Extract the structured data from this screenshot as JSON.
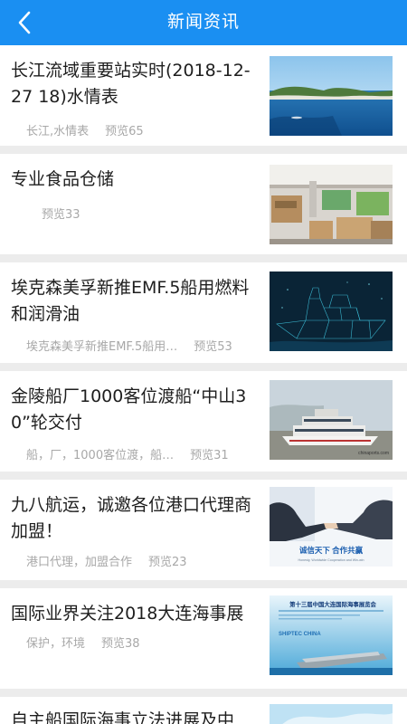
{
  "header": {
    "title": "新闻资讯",
    "back_icon": "chevron-left-icon"
  },
  "items": [
    {
      "title": "长江流域重要站实时(2018-12-27 18)水情表",
      "tags": "长江,水情表",
      "views": "预览65",
      "image": "coastal-bay-photo"
    },
    {
      "title": "专业食品仓储",
      "tags": "",
      "views": "预览33",
      "image": "warehouse-photo"
    },
    {
      "title": "埃克森美孚新推EMF.5船用燃料和润滑油",
      "tags": "埃克森美孚新推EMF.5船用…",
      "views": "预览53",
      "image": "wireframe-ship-graphic"
    },
    {
      "title": "金陵船厂1000客位渡船“中山30”轮交付",
      "tags": "船，厂，1000客位渡，船…",
      "views": "预览31",
      "image": "passenger-ferry-photo",
      "image_caption": "chinaports.com"
    },
    {
      "title": "九八航运，诚邀各位港口代理商加盟！",
      "tags": "港口代理，加盟合作",
      "views": "预览23",
      "image": "handshake-banner",
      "image_text": "诚信天下   合作共赢",
      "image_subtext": "Honesty, Worldwide Cooperation and Win-win"
    },
    {
      "title": "国际业界关注2018大连海事展",
      "tags": "保护，环境",
      "views": "预览38",
      "image": "dalian-expo-poster",
      "image_text": "第十三届中国大连国际海事展览会",
      "image_subtext": "SHIPTEC CHINA"
    },
    {
      "title": "自主船国际海事立法进展及中",
      "tags": "",
      "views": "",
      "image": "sky-photo"
    }
  ]
}
